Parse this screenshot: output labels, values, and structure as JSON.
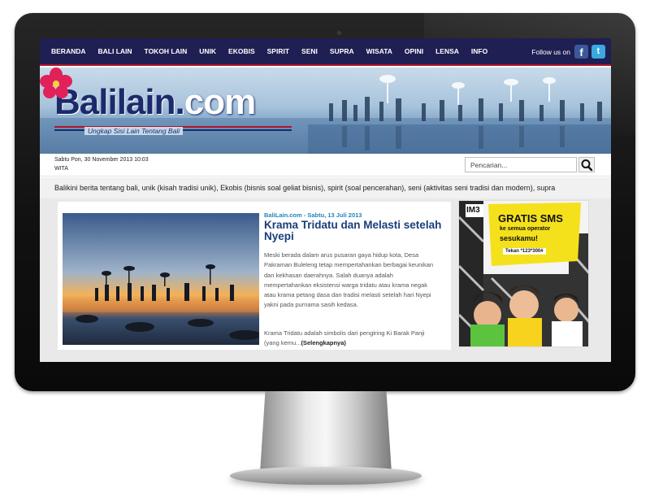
{
  "nav": {
    "items": [
      "BERANDA",
      "BALI LAIN",
      "TOKOH LAIN",
      "UNIK",
      "EKOBIS",
      "SPIRIT",
      "SENI",
      "SUPRA",
      "WISATA",
      "OPINI",
      "LENSA",
      "INFO"
    ],
    "follow_label": "Follow us on",
    "facebook_glyph": "f",
    "twitter_glyph": "t"
  },
  "header": {
    "logo_main": "Balilain",
    "logo_dot": ".",
    "logo_com": "com",
    "tagline": "Ungkap Sisi Lain Tentang Bali"
  },
  "datebar": {
    "date": "Sabtu Pon,  30 November 2013 10:03",
    "zone": "WITA",
    "search_placeholder": "Pencarian..."
  },
  "ticker": "Balikini berita tentang bali, unik (kisah tradisi unik), Ekobis (bisnis soal geliat bisnis), spirit (soal pencerahan), seni (aktivitas seni tradisi dan modern), supra",
  "article": {
    "meta": "BaliLain.com - Sabtu, 13 Juli 2013",
    "title": "Krama Tridatu dan Melasti setelah Nyepi",
    "body1": "Meski berada dalam arus pusaran gaya hidup kota, Desa Pakraman Buleleng tetap mempertahankan berbagai keunikan dan kekhasan daerahnya. Salah duanya adalah mempertahankan eksistensi warga tridatu atau krama negak atau krama petang dasa dan tradisi melasti setelah hari Nyepi yakni pada purnama sasih kedasa.",
    "body2": "Krama Tridatu adalah simbolis dari pengiring Ki Barak Panji (yang kemu...",
    "read_more": "(Selengkapnya)"
  },
  "ad": {
    "brand": "IM3",
    "headline": "GRATIS SMS",
    "sub1": "ke semua operator",
    "sub2": "sesukamu!",
    "code": "Tekan *123*300#"
  },
  "colors": {
    "nav_bg": "#1f1f54",
    "accent_red": "#b0142a",
    "title_blue": "#1a3d7c",
    "meta_blue": "#1d87b9"
  }
}
